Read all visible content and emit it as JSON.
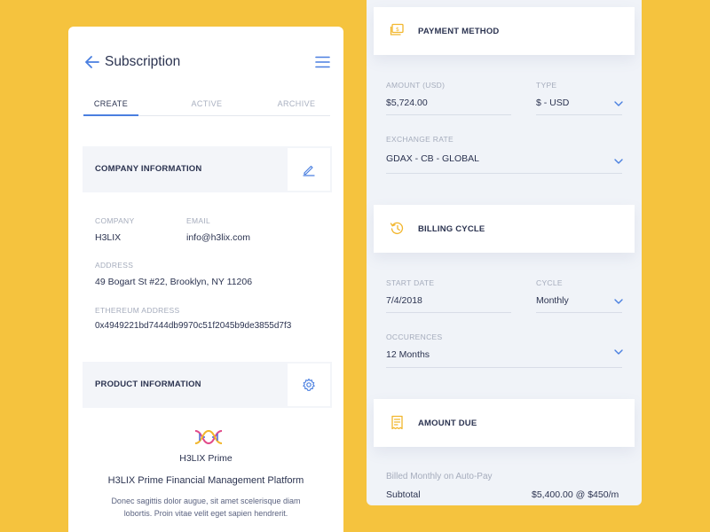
{
  "colors": {
    "background": "#F5C33E",
    "accent": "#4A7FE0",
    "icon_yellow": "#F2B62C",
    "text": "#2B3350",
    "muted": "#A5ACBC"
  },
  "subscription": {
    "title": "Subscription",
    "tabs": [
      {
        "label": "CREATE",
        "active": true
      },
      {
        "label": "ACTIVE",
        "active": false
      },
      {
        "label": "ARCHIVE",
        "active": false
      }
    ],
    "company_section": {
      "title": "COMPANY INFORMATION",
      "company_label": "COMPANY",
      "company_value": "H3LIX",
      "email_label": "EMAIL",
      "email_value": "info@h3lix.com",
      "address_label": "ADDRESS",
      "address_value": "49 Bogart St #22,  Brooklyn,  NY 11206",
      "eth_label": "ETHEREUM ADDRESS",
      "eth_value": "0x4949221bd7444db9970c51f2045b9de3855d7f3"
    },
    "product_section": {
      "title": "PRODUCT INFORMATION",
      "product_name": "H3LIX Prime",
      "product_subtitle": "H3LIX Prime Financial Management Platform",
      "product_description": "Donec sagittis dolor augue, sit amet scelerisque diam lobortis. Proin vitae velit eget sapien hendrerit."
    }
  },
  "payment": {
    "title": "PAYMENT METHOD",
    "amount_label": "AMOUNT (USD)",
    "amount_value": "$5,724.00",
    "type_label": "TYPE",
    "type_value": "$ - USD",
    "exchange_label": "EXCHANGE RATE",
    "exchange_value": "GDAX - CB - GLOBAL"
  },
  "billing": {
    "title": "BILLING CYCLE",
    "start_label": "START DATE",
    "start_value": "7/4/2018",
    "cycle_label": "CYCLE",
    "cycle_value": "Monthly",
    "occ_label": "OCCURENCES",
    "occ_value": "12 Months"
  },
  "amount_due": {
    "title": "AMOUNT DUE",
    "billed_note": "Billed Monthly on Auto-Pay",
    "subtotal_label": "Subtotal",
    "subtotal_value": "$5,400.00 @ $450/m"
  }
}
